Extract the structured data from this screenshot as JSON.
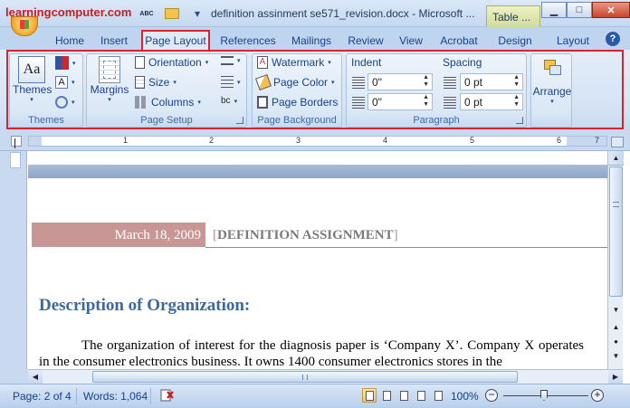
{
  "watermark": "learningcomputer.com",
  "window": {
    "title": "definition assinment se571_revision.docx - Microsoft ...",
    "contextual_tab": "Table ...",
    "controls": {
      "minimize": "▁",
      "maximize": "□",
      "close": "✕"
    }
  },
  "quick_access": {
    "icons": [
      "save-icon",
      "spelling-icon",
      "open-folder-icon",
      "customize-icon"
    ],
    "customize_glyph": "▾",
    "spelling_text": "ABC"
  },
  "tabs": [
    {
      "label": "Home"
    },
    {
      "label": "Insert"
    },
    {
      "label": "Page Layout",
      "active": true
    },
    {
      "label": "References"
    },
    {
      "label": "Mailings"
    },
    {
      "label": "Review"
    },
    {
      "label": "View"
    },
    {
      "label": "Acrobat"
    },
    {
      "label": "Design"
    },
    {
      "label": "Layout"
    }
  ],
  "help_glyph": "?",
  "ribbon": {
    "themes": {
      "group_label": "Themes",
      "themes_button": "Themes",
      "dropdown": "▾"
    },
    "page_setup": {
      "group_label": "Page Setup",
      "margins": "Margins",
      "orientation": "Orientation",
      "size": "Size",
      "columns": "Columns",
      "hyphenation_symbol": "bc"
    },
    "page_background": {
      "group_label": "Page Background",
      "watermark": "Watermark",
      "page_color": "Page Color",
      "page_borders": "Page Borders"
    },
    "paragraph": {
      "group_label": "Paragraph",
      "indent_heading": "Indent",
      "spacing_heading": "Spacing",
      "indent_left": "0\"",
      "indent_right": "0\"",
      "spacing_before": "0 pt",
      "spacing_after": "0 pt"
    },
    "arrange": {
      "label": "Arrange",
      "dropdown": "▾"
    }
  },
  "ruler": {
    "numbers": [
      "1",
      "2",
      "3",
      "4",
      "5",
      "6",
      "7"
    ]
  },
  "document": {
    "header_date": "March 18, 2009",
    "header_title": "DEFINITION ASSIGNMENT",
    "bracket_open": "[",
    "bracket_close": "]",
    "heading": "Description of Organization:",
    "paragraph": "The organization of interest for the diagnosis paper is ‘Company X’. Company X operates in the consumer electronics business. It owns 1400 consumer electronics stores in the"
  },
  "scrollbars": {
    "up_glyph": "▲",
    "down_glyph": "▼",
    "left_glyph": "◀",
    "right_glyph": "▶",
    "prev_page_glyph": "▲",
    "select_object_glyph": "●",
    "next_page_glyph": "▼"
  },
  "status": {
    "page": "Page: 2 of 4",
    "words": "Words: 1,064",
    "zoom": "100%",
    "zoom_minus": "−",
    "zoom_plus": "+"
  },
  "colors": {
    "active_tab_highlight": "#d9232e",
    "header_band": "#c99696",
    "heading": "#3d6a9c",
    "ribbon_text": "#15428b"
  }
}
